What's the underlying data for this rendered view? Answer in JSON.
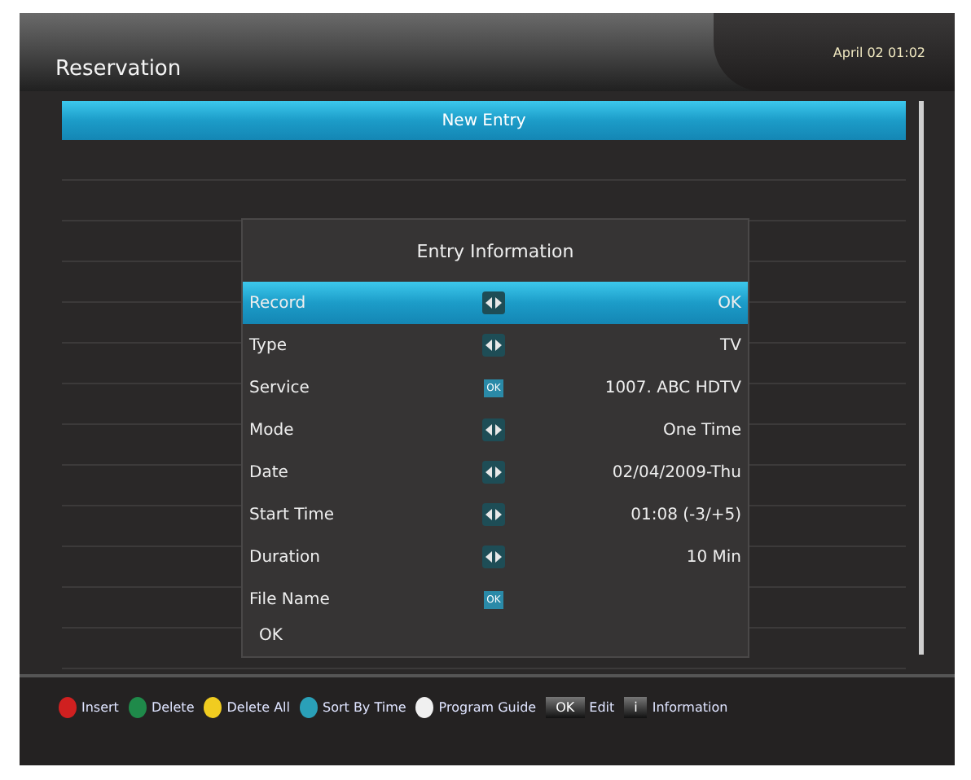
{
  "header": {
    "title": "Reservation",
    "clock": "April 02 01:02"
  },
  "list": {
    "rows": [
      {
        "label": "New Entry",
        "selected": true
      }
    ]
  },
  "dialog": {
    "title": "Entry Information",
    "fields": [
      {
        "label": "Record",
        "kind": "arrows",
        "value": "OK",
        "selected": true
      },
      {
        "label": "Type",
        "kind": "arrows",
        "value": "TV",
        "selected": false
      },
      {
        "label": "Service",
        "kind": "ok",
        "key_label": "OK",
        "value": "1007. ABC HDTV",
        "selected": false
      },
      {
        "label": "Mode",
        "kind": "arrows",
        "value": "One Time",
        "selected": false
      },
      {
        "label": "Date",
        "kind": "arrows",
        "value": "02/04/2009-Thu",
        "selected": false
      },
      {
        "label": "Start Time",
        "kind": "arrows",
        "value": "01:08 (-3/+5)",
        "selected": false
      },
      {
        "label": "Duration",
        "kind": "arrows",
        "value": "10 Min",
        "selected": false
      },
      {
        "label": "File Name",
        "kind": "ok",
        "key_label": "OK",
        "selected": false
      }
    ],
    "button": "OK"
  },
  "legend": [
    {
      "kind": "dot",
      "color": "#d02020",
      "label": "Insert"
    },
    {
      "kind": "dot",
      "color": "#1f8a4a",
      "label": "Delete"
    },
    {
      "kind": "dot",
      "color": "#f0cc20",
      "label": "Delete All"
    },
    {
      "kind": "dot",
      "color": "#2aa0b8",
      "label": "Sort By Time"
    },
    {
      "kind": "dot",
      "color": "#f0f0f0",
      "label": "Program Guide"
    },
    {
      "kind": "key",
      "key_label": "OK",
      "label": "Edit"
    },
    {
      "kind": "key",
      "key_label": "i",
      "label": "Information"
    }
  ]
}
